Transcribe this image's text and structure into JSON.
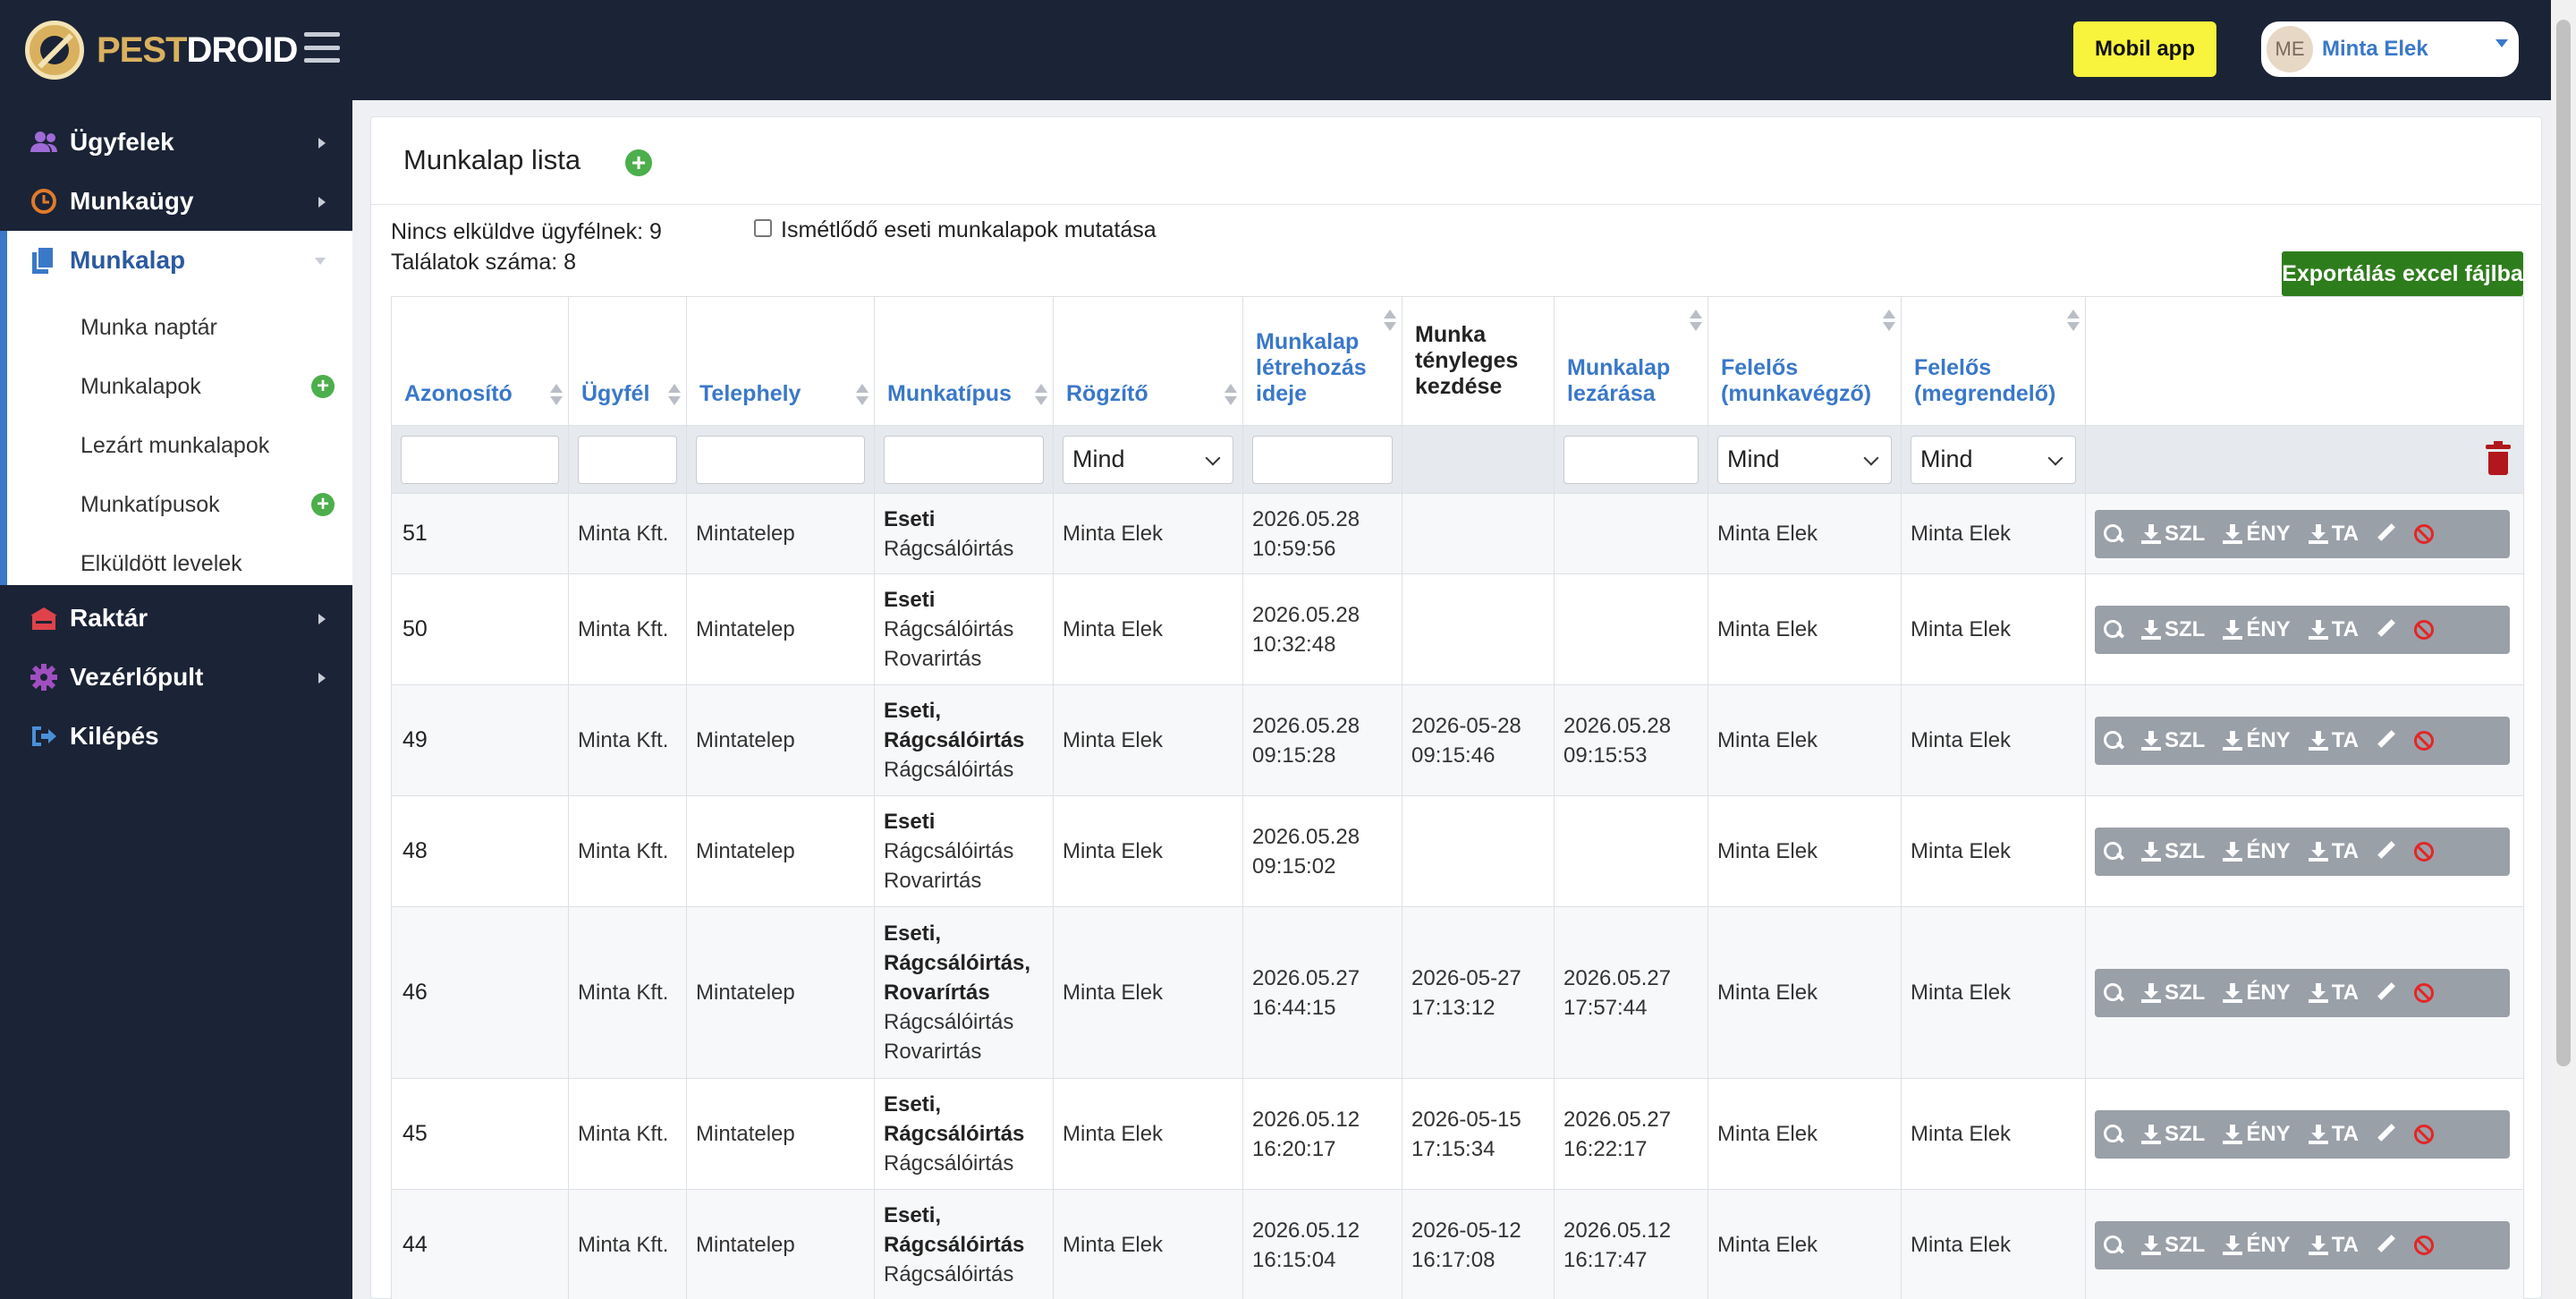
{
  "app": {
    "logo_left": "PEST",
    "logo_right": "DROID"
  },
  "header": {
    "mobile_app_label": "Mobil app",
    "user_initials": "ME",
    "user_name": "Minta Elek"
  },
  "sidebar": {
    "items": [
      {
        "label": "Ügyfelek",
        "icon": "users-icon"
      },
      {
        "label": "Munkaügy",
        "icon": "clock-icon"
      },
      {
        "label": "Munkalap",
        "icon": "documents-icon"
      },
      {
        "label": "Raktár",
        "icon": "warehouse-icon"
      },
      {
        "label": "Vezérlőpult",
        "icon": "gear-icon"
      },
      {
        "label": "Kilépés",
        "icon": "sign-out-icon"
      }
    ],
    "submenu": [
      {
        "label": "Munka naptár"
      },
      {
        "label": "Munkalapok",
        "add": "+"
      },
      {
        "label": "Lezárt munkalapok"
      },
      {
        "label": "Munkatípusok",
        "add": "+"
      },
      {
        "label": "Elküldött levelek"
      }
    ]
  },
  "page": {
    "title": "Munkalap lista",
    "add_symbol": "+",
    "not_sent": "Nincs elküldve ügyfélnek: 9",
    "result_count": "Találatok száma: 8",
    "repeat_checkbox_label": "Ismétlődő eseti munkalapok mutatása",
    "export_label": "Exportálás excel fájlba"
  },
  "table": {
    "headers": {
      "id": "Azonosító",
      "client": "Ügyfél",
      "site": "Telephely",
      "worktype": "Munkatípus",
      "recorder": "Rögzítő",
      "created": "Munkalap létrehozás ideje",
      "actual_start": "Munka tényleges kezdése",
      "closed": "Munkalap lezárása",
      "resp_worker": "Felelős (munkavégző)",
      "resp_orderer": "Felelős (megrendelő)"
    },
    "filters": {
      "recorder": "Mind",
      "resp_worker": "Mind",
      "resp_orderer": "Mind"
    },
    "actions": {
      "szl": "SZL",
      "eny": "ÉNY",
      "ta": "TA"
    },
    "rows": [
      {
        "id": "51",
        "client": "Minta Kft.",
        "site": "Mintatelep",
        "type_bold": "Eseti",
        "type_lines": [
          "Rágcsálóirtás"
        ],
        "recorder": "Minta Elek",
        "created_date": "2026.05.28",
        "created_time": "10:59:56",
        "start_date": "",
        "start_time": "",
        "closed_date": "",
        "closed_time": "",
        "resp_worker": "Minta Elek",
        "resp_orderer": "Minta Elek"
      },
      {
        "id": "50",
        "client": "Minta Kft.",
        "site": "Mintatelep",
        "type_bold": "Eseti",
        "type_lines": [
          "Rágcsálóirtás",
          "Rovarirtás"
        ],
        "recorder": "Minta Elek",
        "created_date": "2026.05.28",
        "created_time": "10:32:48",
        "start_date": "",
        "start_time": "",
        "closed_date": "",
        "closed_time": "",
        "resp_worker": "Minta Elek",
        "resp_orderer": "Minta Elek"
      },
      {
        "id": "49",
        "client": "Minta Kft.",
        "site": "Mintatelep",
        "type_bold": "Eseti, Rágcsálóirtás",
        "type_lines": [
          "Rágcsálóirtás"
        ],
        "recorder": "Minta Elek",
        "created_date": "2026.05.28",
        "created_time": "09:15:28",
        "start_date": "2026-05-28",
        "start_time": "09:15:46",
        "closed_date": "2026.05.28",
        "closed_time": "09:15:53",
        "resp_worker": "Minta Elek",
        "resp_orderer": "Minta Elek"
      },
      {
        "id": "48",
        "client": "Minta Kft.",
        "site": "Mintatelep",
        "type_bold": "Eseti",
        "type_lines": [
          "Rágcsálóirtás",
          "Rovarirtás"
        ],
        "recorder": "Minta Elek",
        "created_date": "2026.05.28",
        "created_time": "09:15:02",
        "start_date": "",
        "start_time": "",
        "closed_date": "",
        "closed_time": "",
        "resp_worker": "Minta Elek",
        "resp_orderer": "Minta Elek"
      },
      {
        "id": "46",
        "client": "Minta Kft.",
        "site": "Mintatelep",
        "type_bold": "Eseti, Rágcsálóirtás, Rovarírtás",
        "type_lines": [
          "Rágcsálóirtás",
          "Rovarirtás"
        ],
        "recorder": "Minta Elek",
        "created_date": "2026.05.27",
        "created_time": "16:44:15",
        "start_date": "2026-05-27",
        "start_time": "17:13:12",
        "closed_date": "2026.05.27",
        "closed_time": "17:57:44",
        "resp_worker": "Minta Elek",
        "resp_orderer": "Minta Elek"
      },
      {
        "id": "45",
        "client": "Minta Kft.",
        "site": "Mintatelep",
        "type_bold": "Eseti, Rágcsálóirtás",
        "type_lines": [
          "Rágcsálóirtás"
        ],
        "recorder": "Minta Elek",
        "created_date": "2026.05.12",
        "created_time": "16:20:17",
        "start_date": "2026-05-15",
        "start_time": "17:15:34",
        "closed_date": "2026.05.27",
        "closed_time": "16:22:17",
        "resp_worker": "Minta Elek",
        "resp_orderer": "Minta Elek"
      },
      {
        "id": "44",
        "client": "Minta Kft.",
        "site": "Mintatelep",
        "type_bold": "Eseti, Rágcsálóirtás",
        "type_lines": [
          "Rágcsálóirtás"
        ],
        "recorder": "Minta Elek",
        "created_date": "2026.05.12",
        "created_time": "16:15:04",
        "start_date": "2026-05-12",
        "start_time": "16:17:08",
        "closed_date": "2026.05.12",
        "closed_time": "16:17:47",
        "resp_worker": "Minta Elek",
        "resp_orderer": "Minta Elek"
      }
    ]
  }
}
